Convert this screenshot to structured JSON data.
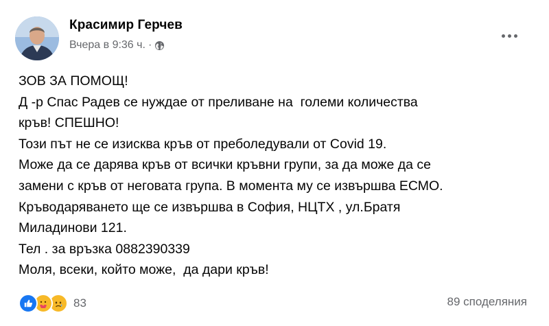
{
  "post": {
    "author": "Красимир Герчев",
    "timestamp": "Вчера в 9:36 ч.",
    "separator": "·",
    "privacy_icon": "globe-icon",
    "more_icon": "more-options-icon",
    "body_lines": [
      "ЗОВ ЗА ПОМОЩ!",
      "Д -р Спас Радев се нуждае от преливане на  големи количества",
      "кръв! СПЕШНО!",
      "Този път не се изисква кръв от преболедували от Covid 19.",
      "Може да се дарява кръв от всички кръвни групи, за да може да се",
      "замени с кръв от неговата група. В момента му се извършва ЕСМО.",
      "Кръводаряването ще се извършва в София, НЦТХ , ул.Братя",
      "Миладинови 121.",
      "Тел . за връзка 0882390339",
      "Моля, всеки, който може,  да дари кръв!"
    ]
  },
  "footer": {
    "reaction_icons": [
      "like-icon",
      "care-icon",
      "sad-icon"
    ],
    "reaction_count": "83",
    "shares_label": "89 споделяния"
  },
  "colors": {
    "text": "#050505",
    "secondary": "#65676b",
    "like_blue": "#1877f2",
    "emoji_yellow": "#f7b928"
  }
}
